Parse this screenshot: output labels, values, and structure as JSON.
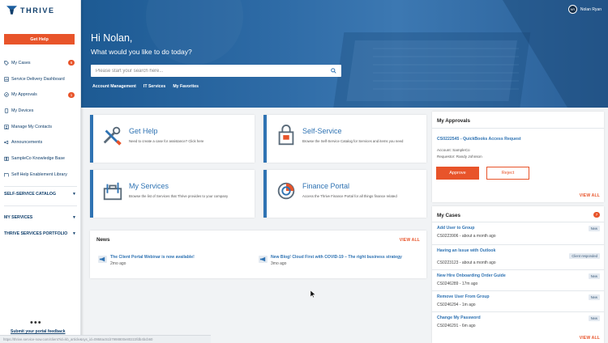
{
  "brand": {
    "name": "THRIVE"
  },
  "sidebar": {
    "get_help_label": "Get Help",
    "items": [
      {
        "label": "My Cases",
        "badge": "6",
        "icon": "tag-icon"
      },
      {
        "label": "Service Delivery Dashboard",
        "icon": "dashboard-icon"
      },
      {
        "label": "My Approvals",
        "badge": "1",
        "icon": "check-circle-icon"
      },
      {
        "label": "My Devices",
        "icon": "device-icon"
      },
      {
        "label": "Manage My Contacts",
        "icon": "contacts-icon"
      },
      {
        "label": "Announcements",
        "icon": "megaphone-icon"
      },
      {
        "label": "SampleCo Knowledge Base",
        "icon": "book-icon"
      },
      {
        "label": "Self Help Enablement Library",
        "icon": "library-icon"
      }
    ],
    "sections": [
      {
        "label": "SELF-SERVICE CATALOG"
      },
      {
        "label": "MY SERVICES"
      },
      {
        "label": "THRIVE SERVICES PORTFOLIO"
      }
    ],
    "more_label": "•••",
    "feedback_label": "Submit your portal feedback",
    "status_url": "https://thrive.service-now.com/client?id=kb_article&sys_id=0958ac51b7998800e80222fdb4bcb60"
  },
  "header": {
    "user_initials": "NR",
    "user_name": "Nolan Ryan",
    "greeting": "Hi Nolan,",
    "prompt": "What would you like to do today?",
    "search_placeholder": "Please start your search here...",
    "quick_links": [
      "Account Management",
      "IT Services",
      "My Favorites"
    ]
  },
  "cards": [
    {
      "title": "Get Help",
      "desc": "Need to create a case for assistance? Click here",
      "icon": "tools-icon"
    },
    {
      "title": "Self-Service",
      "desc": "Browse the Self-Service Catalog for Services and items you need",
      "icon": "shopping-bag-icon"
    },
    {
      "title": "My Services",
      "desc": "Browse the list of Services that Thrive provides to your company",
      "icon": "toolbox-icon"
    },
    {
      "title": "Finance Portal",
      "desc": "Access the Thrive Finance Portal for all things finance related",
      "icon": "pie-chart-icon"
    }
  ],
  "news": {
    "title": "News",
    "view_all": "VIEW ALL",
    "items": [
      {
        "title": "The Client Portal Webinar is now available!",
        "time": "2mo ago"
      },
      {
        "title": "New Blog! Cloud First with COVID-19 – The right business strategy",
        "time": "3mo ago"
      }
    ]
  },
  "approvals": {
    "title": "My Approvals",
    "item_title": "CS0222545 - QuickBooks Access Request",
    "account": "Account: SampleCo",
    "requestor": "Requestor: Randy Johnson",
    "approve_label": "Approve",
    "reject_label": "Reject",
    "view_all": "VIEW ALL"
  },
  "cases": {
    "title": "My Cases",
    "badge": "7",
    "view_all": "VIEW ALL",
    "items": [
      {
        "title": "Add User to Group",
        "meta": "CS0223906 - about a month ago",
        "status": "New"
      },
      {
        "title": "Having an Issue with Outlook",
        "meta": "CS0223123 - about a month ago",
        "status": "Client responded"
      },
      {
        "title": "New Hire Onboarding Order Guide",
        "meta": "CS0246289 - 17m ago",
        "status": "New"
      },
      {
        "title": "Remove User From Group",
        "meta": "CS0246294 - 1m ago",
        "status": "New"
      },
      {
        "title": "Change My Password",
        "meta": "CS0246291 - 6m ago",
        "status": "New"
      }
    ]
  },
  "colors": {
    "accent": "#e8542a",
    "primary": "#2f73b3",
    "navy": "#0f3e6b",
    "hero": "#2d6aa5"
  }
}
